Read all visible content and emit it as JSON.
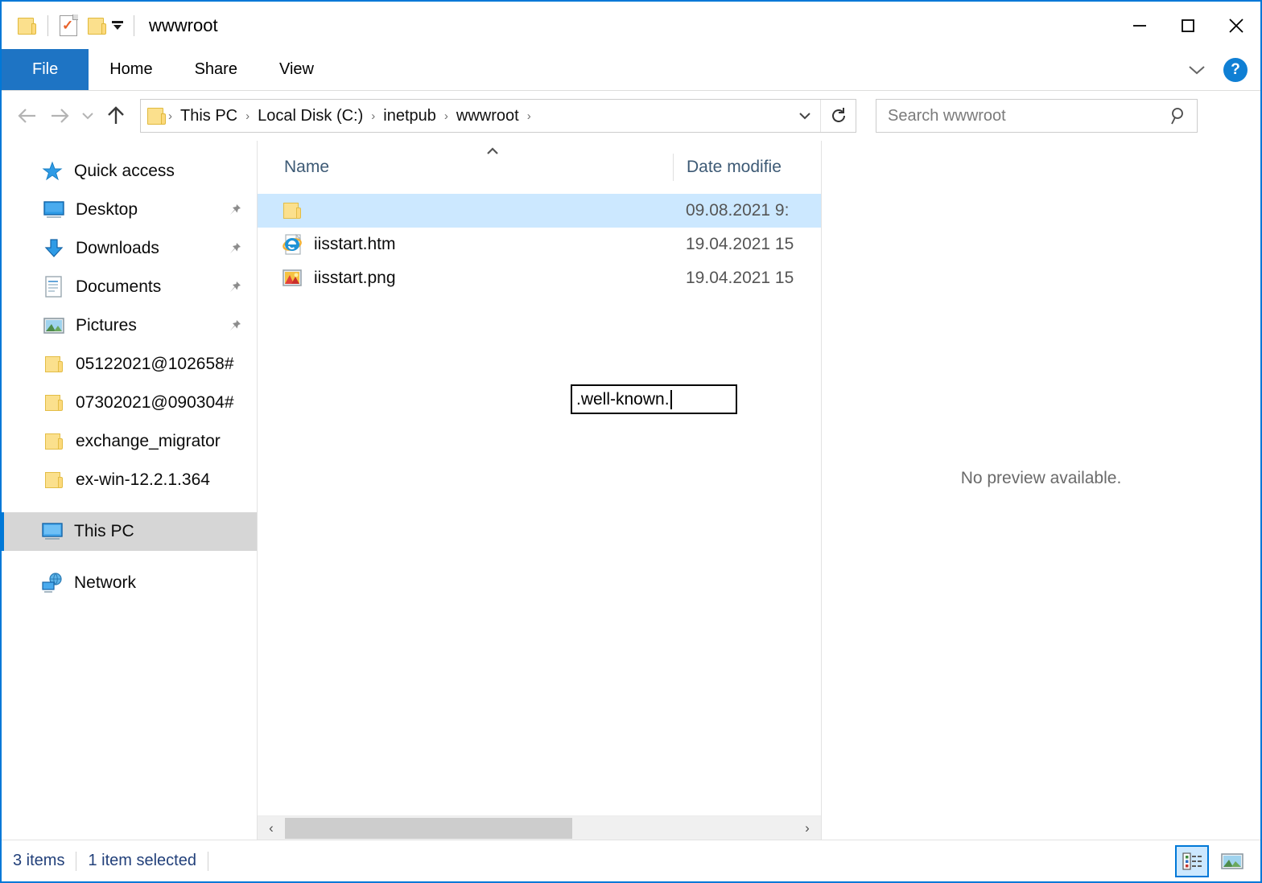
{
  "window": {
    "title": "wwwroot",
    "quick_access_toolbar": [
      {
        "name": "folder-icon",
        "label": "Properties folder"
      },
      {
        "name": "properties-icon",
        "label": "Properties"
      },
      {
        "name": "new-folder-icon",
        "label": "New folder"
      },
      {
        "name": "customize-qat-icon",
        "label": "Customize Quick Access Toolbar"
      }
    ],
    "controls": {
      "minimize": "Minimize",
      "maximize": "Maximize",
      "close": "Close"
    }
  },
  "ribbon": {
    "tabs": [
      {
        "label": "File",
        "active": true
      },
      {
        "label": "Home",
        "active": false
      },
      {
        "label": "Share",
        "active": false
      },
      {
        "label": "View",
        "active": false
      }
    ],
    "collapse_label": "Minimize the Ribbon",
    "help_label": "?"
  },
  "navigation": {
    "back_label": "Back",
    "forward_label": "Forward",
    "recent_label": "Recent locations",
    "up_label": "Up",
    "breadcrumb": [
      "This PC",
      "Local Disk (C:)",
      "inetpub",
      "wwwroot"
    ],
    "breadcrumb_separator": "›",
    "dropdown_label": "Previous locations",
    "refresh_label": "Refresh"
  },
  "search": {
    "placeholder": "Search wwwroot",
    "value": "",
    "icon": "search-icon"
  },
  "sidebar": {
    "items": [
      {
        "label": "Quick access",
        "icon": "star-icon",
        "indent": 0,
        "pinned": false,
        "selected": false
      },
      {
        "label": "Desktop",
        "icon": "desktop-icon",
        "indent": 1,
        "pinned": true,
        "selected": false
      },
      {
        "label": "Downloads",
        "icon": "downloads-icon",
        "indent": 1,
        "pinned": true,
        "selected": false
      },
      {
        "label": "Documents",
        "icon": "documents-icon",
        "indent": 1,
        "pinned": true,
        "selected": false
      },
      {
        "label": "Pictures",
        "icon": "pictures-icon",
        "indent": 1,
        "pinned": true,
        "selected": false
      },
      {
        "label": "05122021@102658#",
        "icon": "folder-icon",
        "indent": 1,
        "pinned": false,
        "selected": false
      },
      {
        "label": "07302021@090304#",
        "icon": "folder-icon",
        "indent": 1,
        "pinned": false,
        "selected": false
      },
      {
        "label": "exchange_migrator",
        "icon": "folder-icon",
        "indent": 1,
        "pinned": false,
        "selected": false
      },
      {
        "label": "ex-win-12.2.1.364",
        "icon": "folder-icon",
        "indent": 1,
        "pinned": false,
        "selected": false
      },
      {
        "label": "This PC",
        "icon": "this-pc-icon",
        "indent": 0,
        "pinned": false,
        "selected": true
      },
      {
        "label": "Network",
        "icon": "network-icon",
        "indent": 0,
        "pinned": false,
        "selected": false
      }
    ]
  },
  "filelist": {
    "columns": [
      {
        "label": "Name",
        "sorted": "asc"
      },
      {
        "label": "Date modifie"
      }
    ],
    "rows": [
      {
        "name": "",
        "date": "09.08.2021 9:",
        "icon": "folder-icon",
        "selected": true,
        "renaming": true
      },
      {
        "name": "iisstart.htm",
        "date": "19.04.2021 15",
        "icon": "internet-explorer-icon",
        "selected": false,
        "renaming": false
      },
      {
        "name": "iisstart.png",
        "date": "19.04.2021 15",
        "icon": "image-file-icon",
        "selected": false,
        "renaming": false
      }
    ],
    "rename_value": ".well-known.",
    "scroll_left_label": "Scroll left",
    "scroll_right_label": "Scroll right"
  },
  "preview": {
    "message": "No preview available."
  },
  "status": {
    "item_count": "3 items",
    "selection": "1 item selected",
    "view_buttons": [
      {
        "name": "details-view",
        "label": "Details view",
        "active": true
      },
      {
        "name": "large-icons-view",
        "label": "Large icons view",
        "active": false
      }
    ]
  },
  "colors": {
    "window_border": "#0078d7",
    "accent": "#1e74c4",
    "selection": "#cce8ff",
    "nav_selection": "#d6d6d6",
    "folder_yellow": "#fbe08d",
    "status_text": "#22407a"
  }
}
